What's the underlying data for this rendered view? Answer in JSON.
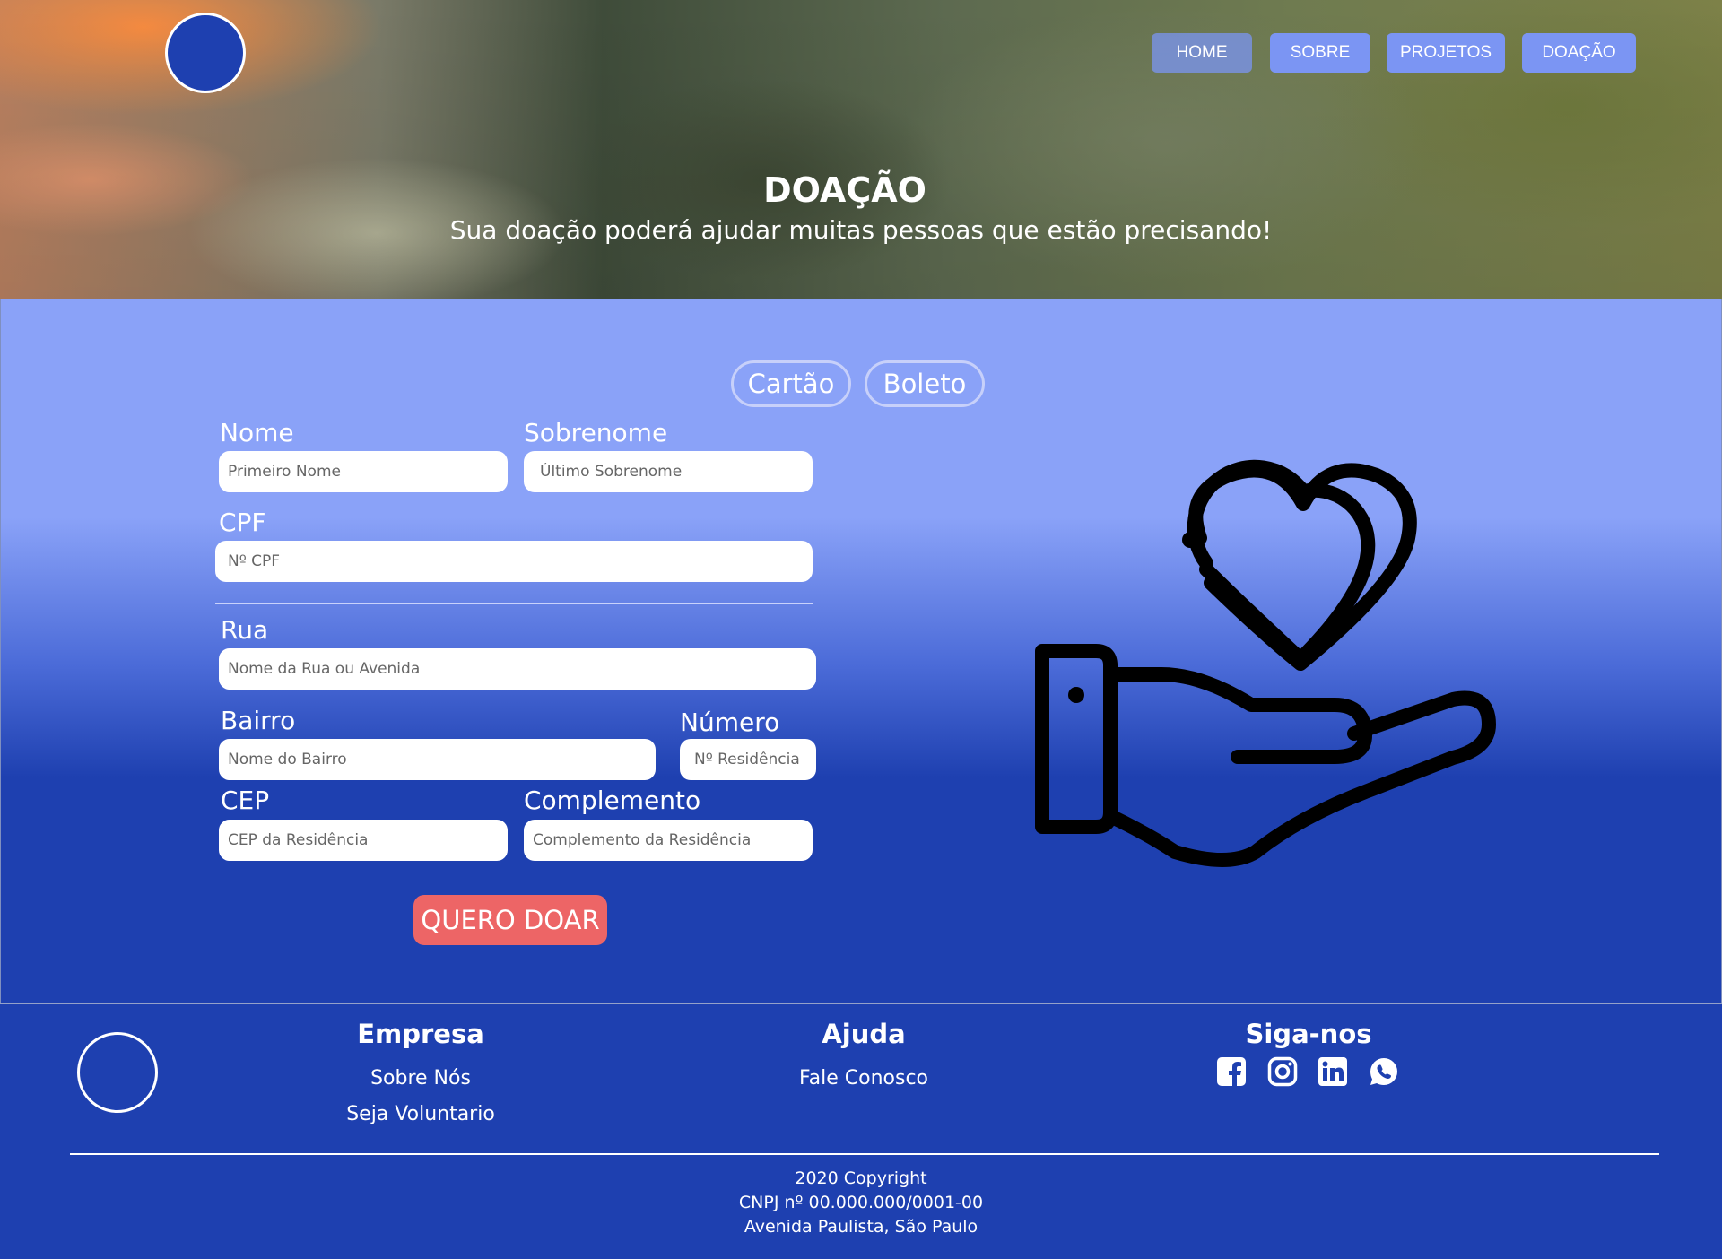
{
  "nav": {
    "items": [
      {
        "label": "HOME",
        "active": true
      },
      {
        "label": "SOBRE"
      },
      {
        "label": "PROJETOS"
      },
      {
        "label": "DOAÇÃO"
      }
    ]
  },
  "hero": {
    "title": "DOAÇÃO",
    "subtitle": "Sua doação poderá ajudar muitas pessoas que estão precisando!"
  },
  "payment_tabs": [
    "Cartão",
    "Boleto"
  ],
  "form": {
    "nome_label": "Nome",
    "nome_placeholder": "Primeiro Nome",
    "sobrenome_label": "Sobrenome",
    "sobrenome_placeholder": "Último Sobrenome",
    "cpf_label": "CPF",
    "cpf_placeholder": "Nº CPF",
    "rua_label": "Rua",
    "rua_placeholder": "Nome da Rua ou Avenida",
    "bairro_label": "Bairro",
    "bairro_placeholder": "Nome do Bairro",
    "numero_label": "Número",
    "numero_placeholder": "Nº Residência",
    "cep_label": "CEP",
    "cep_placeholder": "CEP da Residência",
    "complemento_label": "Complemento",
    "complemento_placeholder": "Complemento da Residência",
    "submit_label": "QUERO DOAR"
  },
  "illustration": {
    "icon": "hand-heart-icon"
  },
  "footer": {
    "empresa_title": "Empresa",
    "empresa_links": [
      "Sobre Nós",
      "Seja Voluntario"
    ],
    "ajuda_title": "Ajuda",
    "ajuda_links": [
      "Fale Conosco"
    ],
    "siga_title": "Siga-nos",
    "social_icons": [
      "facebook-icon",
      "instagram-icon",
      "linkedin-icon",
      "whatsapp-icon"
    ],
    "copyright": "2020 Copyright",
    "cnpj": "CNPJ nº 00.000.000/0001-00",
    "address": "Avenida Paulista, São Paulo"
  },
  "colors": {
    "primary_blue": "#1e40b0",
    "light_blue": "#8aa2f8",
    "cta_red": "#ed6566",
    "nav_button": "#7b95f3"
  }
}
